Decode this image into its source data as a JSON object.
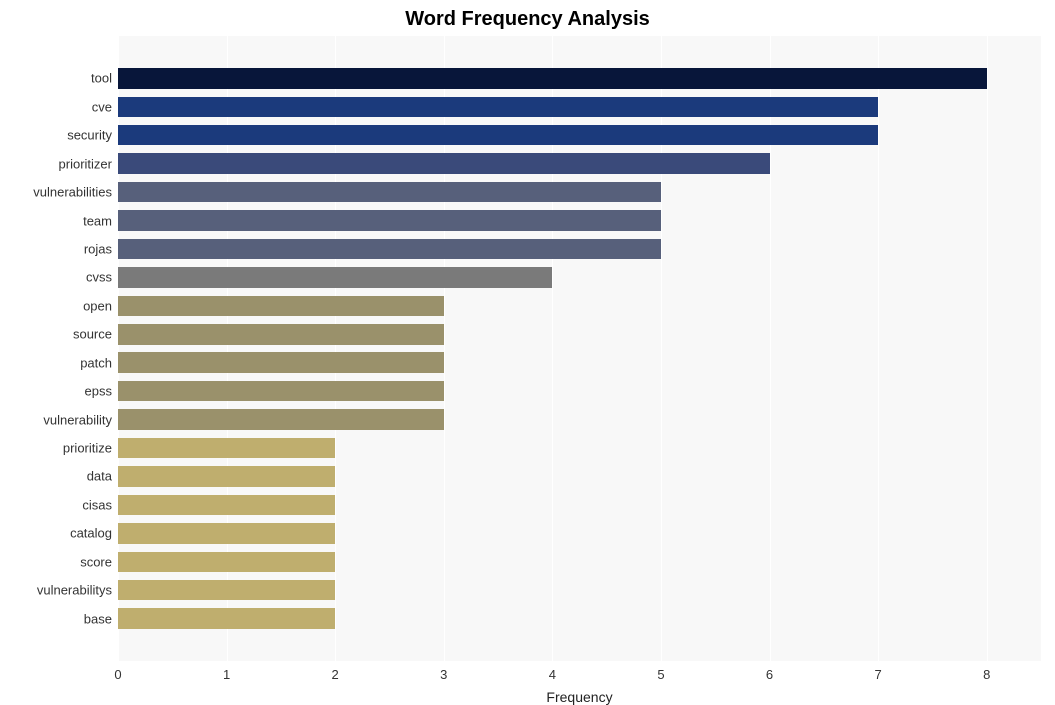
{
  "chart_data": {
    "type": "bar",
    "title": "Word Frequency Analysis",
    "xlabel": "Frequency",
    "ylabel": "",
    "xlim": [
      0,
      8.5
    ],
    "xticks": [
      0,
      1,
      2,
      3,
      4,
      5,
      6,
      7,
      8
    ],
    "categories": [
      "tool",
      "cve",
      "security",
      "prioritizer",
      "vulnerabilities",
      "team",
      "rojas",
      "cvss",
      "open",
      "source",
      "patch",
      "epss",
      "vulnerability",
      "prioritize",
      "data",
      "cisas",
      "catalog",
      "score",
      "vulnerabilitys",
      "base"
    ],
    "values": [
      8,
      7,
      7,
      6,
      5,
      5,
      5,
      4,
      3,
      3,
      3,
      3,
      3,
      2,
      2,
      2,
      2,
      2,
      2,
      2
    ],
    "colors": [
      "#08163a",
      "#1b3a7c",
      "#1b3a7c",
      "#3a4a7a",
      "#57607b",
      "#57607b",
      "#57607b",
      "#7a7a7a",
      "#9a916b",
      "#9a916b",
      "#9a916b",
      "#9a916b",
      "#9a916b",
      "#bfae6e",
      "#bfae6e",
      "#bfae6e",
      "#bfae6e",
      "#bfae6e",
      "#bfae6e",
      "#bfae6e"
    ]
  }
}
